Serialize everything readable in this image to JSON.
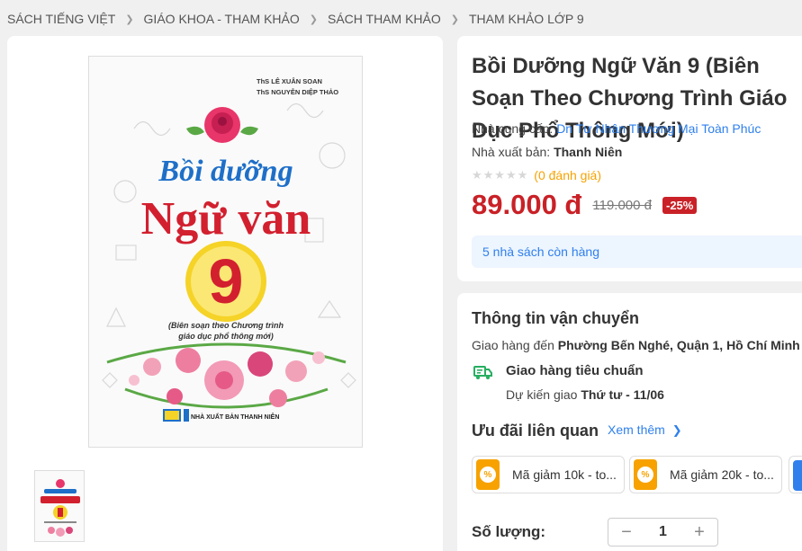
{
  "breadcrumb": [
    "SÁCH TIẾNG VIỆT",
    "GIÁO KHOA - THAM KHẢO",
    "SÁCH THAM KHẢO",
    "THAM KHẢO LỚP 9"
  ],
  "cover": {
    "authors": [
      "ThS LÊ XUÂN SOAN",
      "ThS NGUYỄN DIỆP THẢO"
    ],
    "title_top": "Bồi dưỡng",
    "title_main": "Ngữ văn",
    "grade": "9",
    "subtitle_1": "(Biên soạn theo Chương trình",
    "subtitle_2": "giáo dục phổ thông mới)",
    "publisher": "NHÀ XUẤT BẢN THANH NIÊN"
  },
  "product": {
    "title": "Bồi Dưỡng Ngữ Văn 9 (Biên Soạn Theo Chương Trình Giáo Dục Phổ Thông Mới)",
    "supplier_label": "Nhà cung cấp:",
    "supplier": "Dn Tư Nhân Thương Mại Toàn Phúc",
    "publisher_label": "Nhà xuất bản:",
    "publisher": "Thanh Niên",
    "stars": "★★★★★",
    "rating_count": "(0 đánh giá)",
    "price": "89.000 đ",
    "old_price": "119.000 đ",
    "discount": "-25%",
    "stock": "5 nhà sách còn hàng"
  },
  "shipping": {
    "title": "Thông tin vận chuyển",
    "deliver_label": "Giao hàng đến",
    "address": "Phường Bến Nghé, Quận 1, Hồ Chí Minh",
    "method": "Giao hàng tiêu chuẩn",
    "eta_label": "Dự kiến giao",
    "eta": "Thứ tư - 11/06"
  },
  "promos": {
    "title": "Ưu đãi liên quan",
    "see_more": "Xem thêm",
    "coupons": [
      "Mã giảm 10k - to...",
      "Mã giảm 20k - to..."
    ]
  },
  "quantity": {
    "label": "Số lượng:",
    "value": "1",
    "minus": "−",
    "plus": "+"
  },
  "colors": {
    "accent_red": "#c92127",
    "link_blue": "#2f80ed",
    "star_orange": "#f7a200",
    "ship_green": "#27ae60"
  }
}
